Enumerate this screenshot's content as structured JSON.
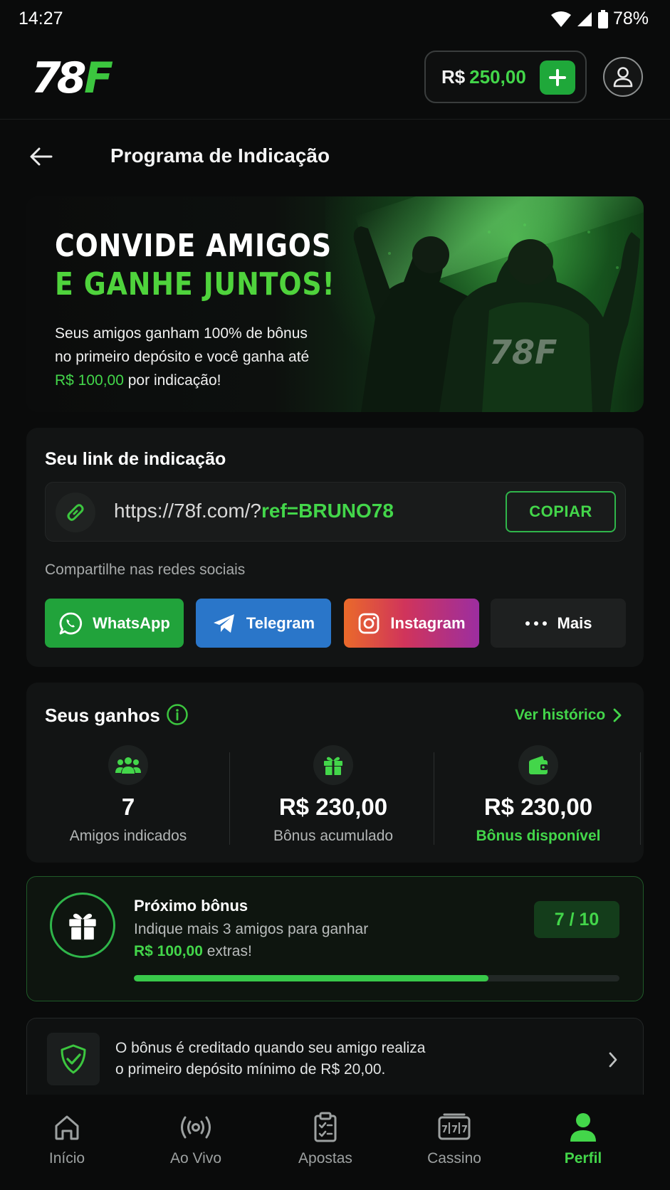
{
  "status_bar": {
    "time": "14:27",
    "battery": "78%"
  },
  "header": {
    "logo_text": "78F",
    "balance_currency": "R$",
    "balance_value": "250,00"
  },
  "page": {
    "title": "Programa de Indicação"
  },
  "hero": {
    "title_line_1": "CONVIDE AMIGOS",
    "title_line_2": "E GANHE JUNTOS!",
    "desc_part_1": "Seus amigos ganham 100% de bônus no primeiro depósito e você ganha até ",
    "desc_highlight": "R$ 100,00",
    "desc_part_2": " por indicação!",
    "jersey_logo": "78F"
  },
  "referral": {
    "title": "Seu link de indicação",
    "link_prefix": "https://78f.com/?",
    "link_code": "ref=BRUNO78",
    "copy_label": "COPIAR",
    "share_label": "Compartilhe nas redes sociais",
    "share_buttons": [
      {
        "label": "WhatsApp",
        "icon": "whatsapp-icon",
        "color": "#21a33b"
      },
      {
        "label": "Telegram",
        "icon": "telegram-icon",
        "color": "#2a76c9"
      },
      {
        "label": "Instagram",
        "icon": "instagram-icon",
        "color": "#d0345b"
      },
      {
        "label": "Mais",
        "icon": "more-dots-icon",
        "color": "#1e2020"
      }
    ]
  },
  "earnings": {
    "title": "Seus ganhos",
    "history_label": "Ver histórico",
    "stats": [
      {
        "value": "7",
        "label": "Amigos indicados",
        "icon": "friends-icon"
      },
      {
        "value": "R$ 230,00",
        "label": "Bônus acumulado",
        "icon": "gift-icon"
      },
      {
        "value": "R$ 230,00",
        "label": "Bônus disponível",
        "icon": "wallet-icon"
      }
    ]
  },
  "next_bonus": {
    "title": "Próximo bônus",
    "line_1": "Indique mais 3 amigos para ganhar",
    "amount": "R$ 100,00",
    "line_2_suffix": " extras!",
    "count": "7 / 10",
    "progress": 0.73
  },
  "info": {
    "text_line_1": "O bônus é creditado quando seu amigo realiza",
    "text_line_2": "o primeiro depósito mínimo de R$ 20,00."
  },
  "bottom_nav": {
    "items": [
      {
        "label": "Início",
        "icon": "home-icon"
      },
      {
        "label": "Ao Vivo",
        "icon": "live-icon"
      },
      {
        "label": "Apostas",
        "icon": "bets-icon"
      },
      {
        "label": "Cassino",
        "icon": "slot-machine-icon"
      },
      {
        "label": "Perfil",
        "icon": "profile-icon",
        "active": true
      }
    ]
  },
  "colors": {
    "accent": "#43d64a",
    "background": "#0a0b0b",
    "card": "#121414"
  }
}
